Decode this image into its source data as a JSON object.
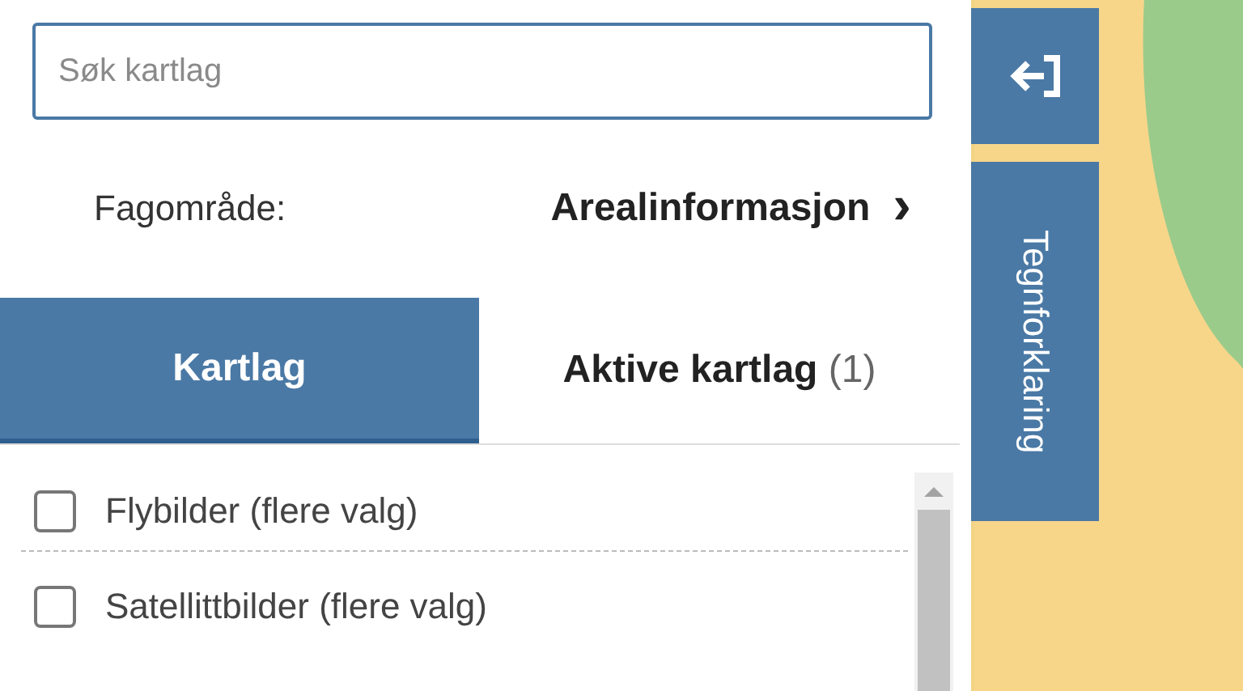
{
  "search": {
    "placeholder": "Søk kartlag"
  },
  "subject": {
    "label": "Fagområde:",
    "value": "Arealinformasjon",
    "chevron": "›"
  },
  "tabs": [
    {
      "label": "Kartlag",
      "selected": true
    },
    {
      "label": "Aktive kartlag",
      "count": "(1)",
      "selected": false
    }
  ],
  "layers": [
    {
      "label": "Flybilder (flere valg)",
      "checked": false
    },
    {
      "label": "Satellittbilder (flere valg)",
      "checked": false
    }
  ],
  "side_buttons": [
    {
      "kind": "icon"
    },
    {
      "kind": "text",
      "label": "Tegnforklaring"
    }
  ]
}
